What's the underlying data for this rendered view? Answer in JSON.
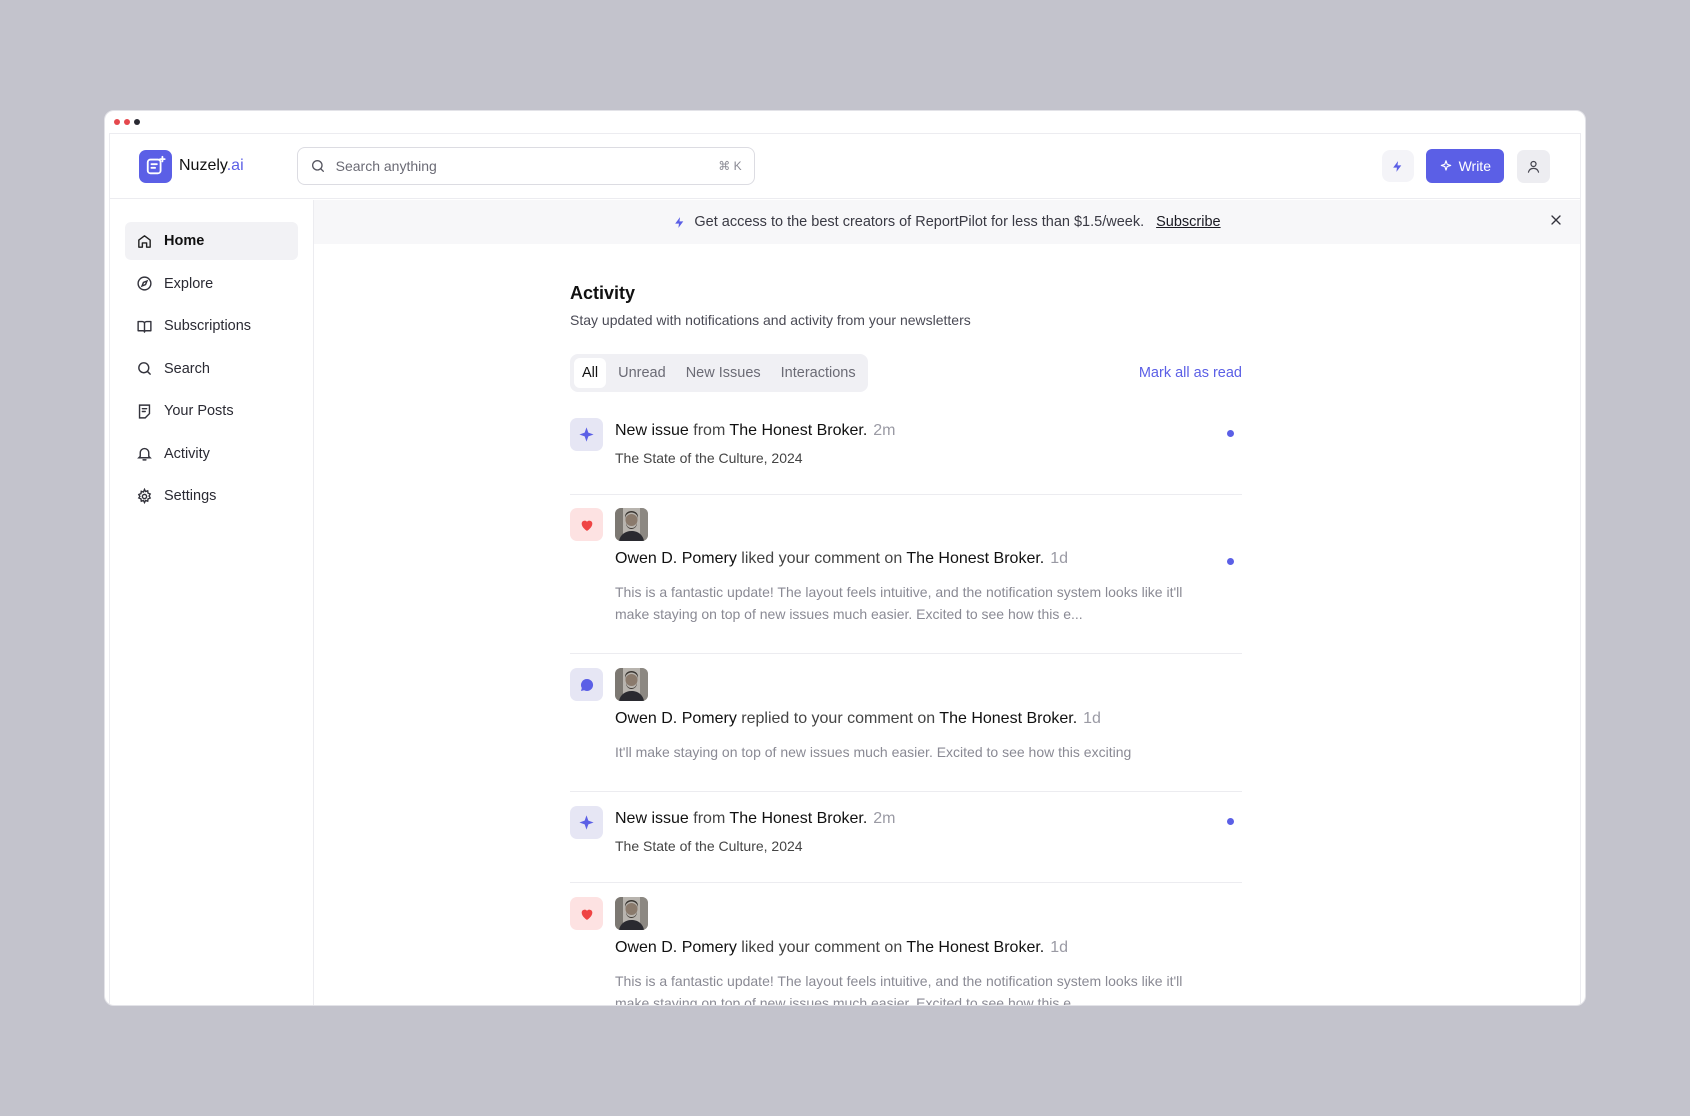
{
  "app": {
    "brand_name": "Nuzely",
    "brand_suffix": ".ai",
    "accent_color": "#5b5fe6"
  },
  "header": {
    "search_placeholder": "Search anything",
    "search_shortcut": "⌘ K",
    "write_label": "Write"
  },
  "sidebar": {
    "items": [
      {
        "label": "Home",
        "icon": "home-icon",
        "active": true
      },
      {
        "label": "Explore",
        "icon": "compass-icon"
      },
      {
        "label": "Subscriptions",
        "icon": "book-icon"
      },
      {
        "label": "Search",
        "icon": "search-icon"
      },
      {
        "label": "Your Posts",
        "icon": "posts-icon"
      },
      {
        "label": "Activity",
        "icon": "bell-icon"
      },
      {
        "label": "Settings",
        "icon": "gear-icon"
      }
    ]
  },
  "banner": {
    "text": "Get access to the best creators of ReportPilot for less than $1.5/week.",
    "link": "Subscribe"
  },
  "activity": {
    "title": "Activity",
    "subtitle": "Stay updated with notifications and activity from your newsletters",
    "tabs": [
      "All",
      "Unread",
      "New Issues",
      "Interactions"
    ],
    "mark_all": "Mark all as read",
    "items": [
      {
        "type": "new-issue",
        "actor": "New issue",
        "verb": "from",
        "target": "The Honest Broker.",
        "time": "2m",
        "detail": "The State of the Culture, 2024",
        "unread": true
      },
      {
        "type": "like",
        "actor": "Owen D. Pomery",
        "verb": "liked your comment on",
        "target": "The Honest Broker.",
        "time": "1d",
        "detail": "This is a fantastic update! The layout feels intuitive, and the notification system looks like it'll make staying on top of new issues much easier. Excited to see how this e...",
        "unread": true
      },
      {
        "type": "reply",
        "actor": "Owen D. Pomery",
        "verb": "replied to your comment on",
        "target": "The Honest Broker.",
        "time": "1d",
        "detail": "It'll make staying on top of new issues much easier. Excited to see how this exciting",
        "unread": false
      },
      {
        "type": "new-issue",
        "actor": "New issue",
        "verb": "from",
        "target": "The Honest Broker.",
        "time": "2m",
        "detail": "The State of the Culture, 2024",
        "unread": true
      },
      {
        "type": "like",
        "actor": "Owen D. Pomery",
        "verb": "liked your comment on",
        "target": "The Honest Broker.",
        "time": "1d",
        "detail": "This is a fantastic update! The layout feels intuitive, and the notification system looks like it'll make staying on top of new issues much easier. Excited to see how this e...",
        "unread": false
      }
    ]
  }
}
